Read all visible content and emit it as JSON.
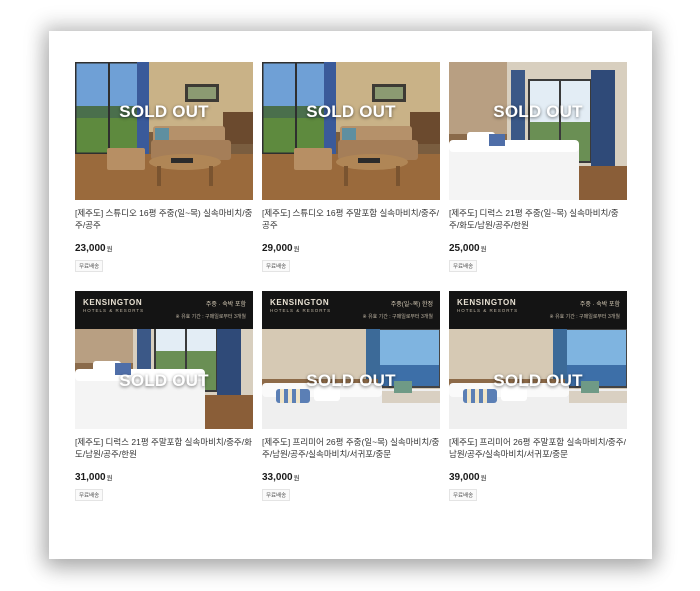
{
  "overlay_label": "SOLD OUT",
  "products": [
    {
      "title": "[제주도] 스튜디오 16평 주중(일~목) 실속마비치/중주/공주",
      "price": "23,000",
      "currency": "원",
      "shipping": "무료배송",
      "image": "studio-lounge",
      "banner": null
    },
    {
      "title": "[제주도] 스튜디오 16평 주말포함 실속마비치/중주/공주",
      "price": "29,000",
      "currency": "원",
      "shipping": "무료배송",
      "image": "studio-lounge",
      "banner": null
    },
    {
      "title": "[제주도] 디럭스 21평 주중(일~목) 실속마비치/중주/화도/남원/공주/한원",
      "price": "25,000",
      "currency": "원",
      "shipping": "무료배송",
      "image": "deluxe-bed",
      "banner": null
    },
    {
      "title": "[제주도] 디럭스 21평 주말포함 실속마비치/중주/화도/남원/공주/한원",
      "price": "31,000",
      "currency": "원",
      "shipping": "무료배송",
      "image": "deluxe-bed",
      "banner": {
        "brand": "KENSINGTON",
        "brand_sub": "HOTELS & RESORTS",
        "promo": "주중 · 숙박 포함",
        "validity": "※ 유효 기간 : 구매일로부터 3개월"
      }
    },
    {
      "title": "[제주도] 프리미어 26평 주중(일~목) 실속마비치/중주/남원/공주/실속마비치/서귀포/중문",
      "price": "33,000",
      "currency": "원",
      "shipping": "무료배송",
      "image": "premier-bed",
      "banner": {
        "brand": "KENSINGTON",
        "brand_sub": "HOTELS & RESORTS",
        "promo": "주중(일~목) 한정",
        "validity": "※ 유효 기간 : 구매일로부터 3개월"
      }
    },
    {
      "title": "[제주도] 프리미어 26평 주말포함 실속마비치/중주/남원/공주/실속마비치/서귀포/중문",
      "price": "39,000",
      "currency": "원",
      "shipping": "무료배송",
      "image": "premier-bed",
      "banner": {
        "brand": "KENSINGTON",
        "brand_sub": "HOTELS & RESORTS",
        "promo": "주중 · 숙박 포함",
        "validity": "※ 유효 기간 : 구매일로부터 3개월"
      }
    }
  ]
}
